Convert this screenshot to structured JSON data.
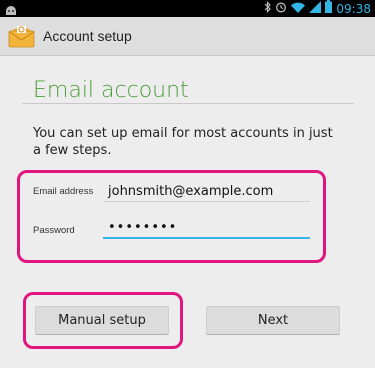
{
  "status_bar": {
    "time": "09:38",
    "icons": [
      "android-notification-icon",
      "bluetooth-icon",
      "alarm-icon",
      "wifi-icon",
      "signal-icon",
      "battery-icon"
    ]
  },
  "action_bar": {
    "title": "Account setup",
    "icon": "email-envelope-icon"
  },
  "main": {
    "heading": "Email account",
    "intro": "You can set up email for most accounts in just a few steps.",
    "email_label": "Email address",
    "email_value": "johnsmith@example.com",
    "password_label": "Password",
    "password_value": "••••••••"
  },
  "buttons": {
    "manual_setup": "Manual setup",
    "next": "Next"
  },
  "colors": {
    "accent_green": "#4a9e3a",
    "focus_blue": "#33b5e5",
    "highlight_pink": "#e0157d"
  }
}
